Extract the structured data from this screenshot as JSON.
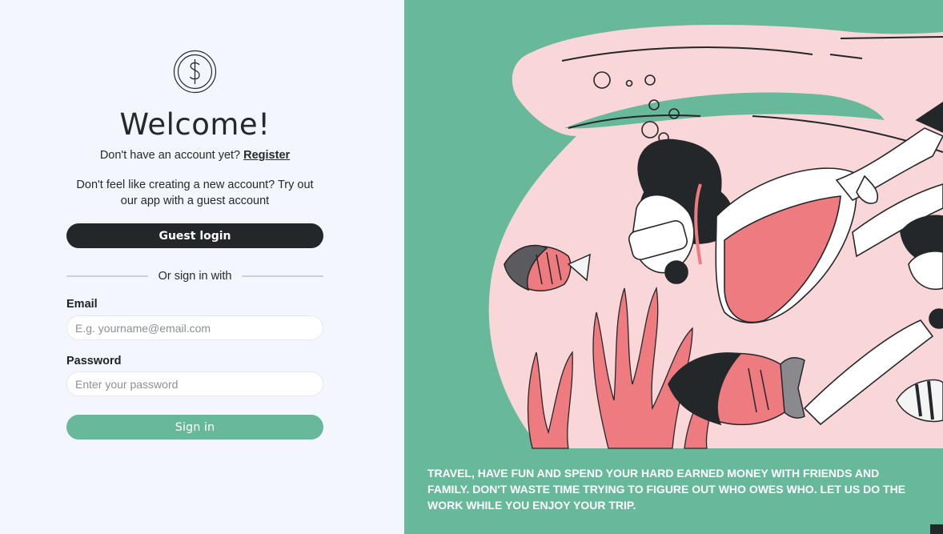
{
  "login": {
    "title": "Welcome!",
    "no_account_text": "Don't have an account yet?",
    "register_link": "Register",
    "guest_prompt": "Don't feel like creating a new account? Try out our app with a guest account",
    "guest_button": "Guest login",
    "divider_text": "Or sign in with",
    "email_label": "Email",
    "email_placeholder": "E.g. yourname@email.com",
    "email_value": "",
    "password_label": "Password",
    "password_placeholder": "Enter your password",
    "password_value": "",
    "signin_button": "Sign in",
    "logo_icon": "dollar-coin-icon"
  },
  "hero": {
    "tagline": "TRAVEL, HAVE FUN AND SPEND YOUR HARD EARNED MONEY WITH FRIENDS AND FAMILY. DON'T WASTE TIME TRYING TO FIGURE OUT WHO OWES WHO. LET US DO THE WORK WHILE YOU ENJOY YOUR TRIP."
  },
  "colors": {
    "accent_green": "#68b89b",
    "dark": "#24272a",
    "panel_bg": "#f3f6fd",
    "pink": "#f9d6d8",
    "coral": "#ee7b80"
  }
}
